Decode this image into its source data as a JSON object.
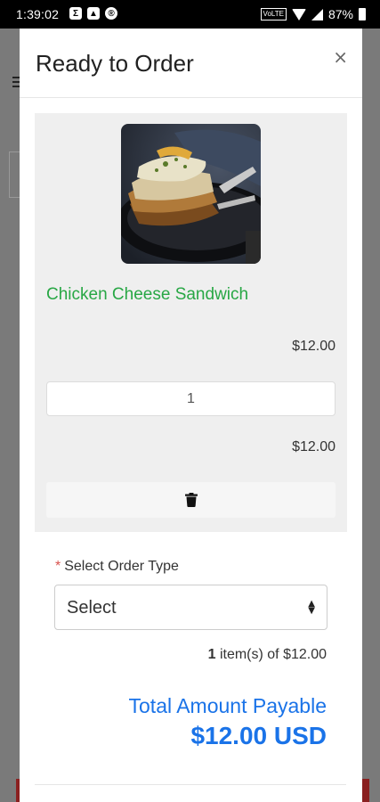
{
  "status_bar": {
    "time": "1:39:02",
    "network": "VoLTE",
    "battery": "87%"
  },
  "modal": {
    "title": "Ready to Order",
    "close_symbol": "×"
  },
  "cart_item": {
    "name": "Chicken Cheese Sandwich",
    "unit_price": "$12.00",
    "quantity": "1",
    "line_total": "$12.00",
    "image_icon": "sandwich-photo"
  },
  "order_type": {
    "label": "Select Order Type",
    "required_marker": "*",
    "selected": "Select"
  },
  "summary": {
    "item_count": "1",
    "items_text": " item(s) of $12.00",
    "total_label": "Total Amount Payable",
    "total_amount": "$12.00 USD"
  },
  "colors": {
    "accent_green": "#28a745",
    "accent_blue": "#1a73e8",
    "required_red": "#d9534f"
  }
}
